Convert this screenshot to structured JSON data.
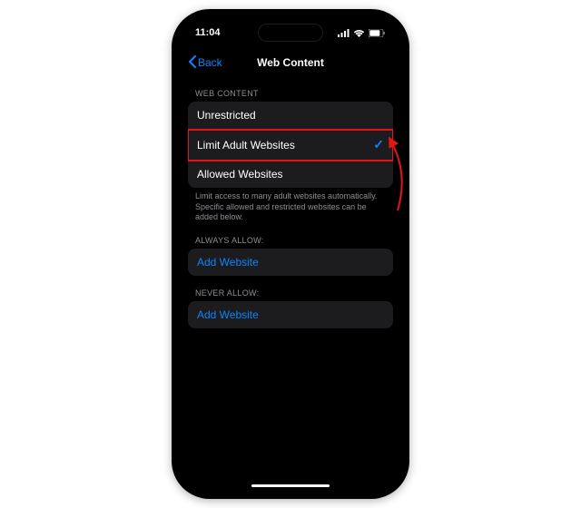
{
  "status": {
    "time": "11:04"
  },
  "nav": {
    "back": "Back",
    "title": "Web Content"
  },
  "sections": {
    "webContent": {
      "header": "WEB CONTENT",
      "options": {
        "unrestricted": "Unrestricted",
        "limitAdult": "Limit Adult Websites",
        "allowed": "Allowed Websites"
      },
      "footer": "Limit access to many adult websites automatically. Specific allowed and restricted websites can be added below."
    },
    "alwaysAllow": {
      "header": "ALWAYS ALLOW:",
      "add": "Add Website"
    },
    "neverAllow": {
      "header": "NEVER ALLOW:",
      "add": "Add Website"
    }
  },
  "colors": {
    "accent": "#0A84FF",
    "highlight": "#E51515"
  }
}
